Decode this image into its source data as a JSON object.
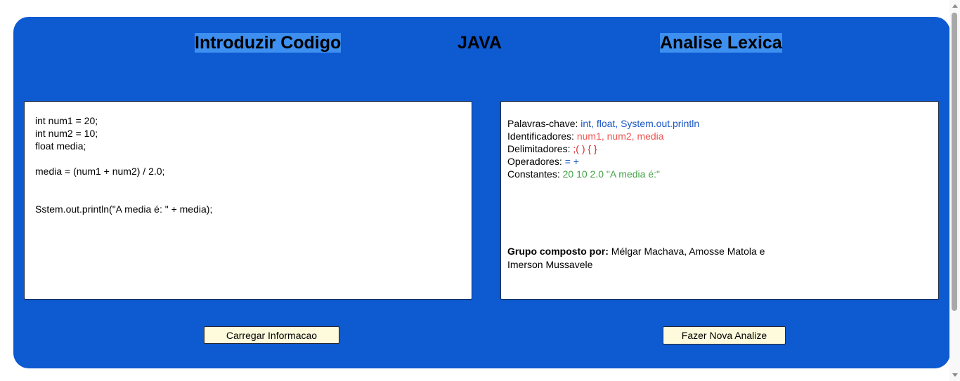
{
  "headings": {
    "intro": "Introduzir Codigo",
    "lang": "JAVA",
    "analise": "Analise Lexica"
  },
  "code_lines": [
    "int num1 = 20;",
    "int num2 = 10;",
    "float media;",
    "",
    "media = (num1 + num2) / 2.0;",
    "",
    "",
    "Sstem.out.println(\"A media é: \" + media);"
  ],
  "analysis": {
    "keywords_label": "Palavras-chave: ",
    "keywords_value": "int, float, System.out.println",
    "identifiers_label": "Identificadores: ",
    "identifiers_value": "num1, num2, media",
    "delimiters_label": "Delimitadores: ",
    "delimiters_value": ";( ) { }",
    "operators_label": "Operadores: ",
    "operators_value": "= +",
    "constants_label": "Constantes: ",
    "constants_value": "20 10 2.0 \"A media é:\""
  },
  "credits": {
    "label": "Grupo composto por:",
    "names": " Mélgar Machava, Amosse Matola e Imerson Mussavele"
  },
  "buttons": {
    "load": "Carregar Informacao",
    "new_analysis": "Fazer Nova Analize"
  },
  "colors": {
    "panel": "#0d5ad1",
    "heading_highlight": "#3d8ff0",
    "button_bg": "#fefbdc",
    "keywords": "#1a56c4",
    "identifiers": "#ef5350",
    "delimiters": "#d32f2f",
    "constants": "#43a047"
  }
}
